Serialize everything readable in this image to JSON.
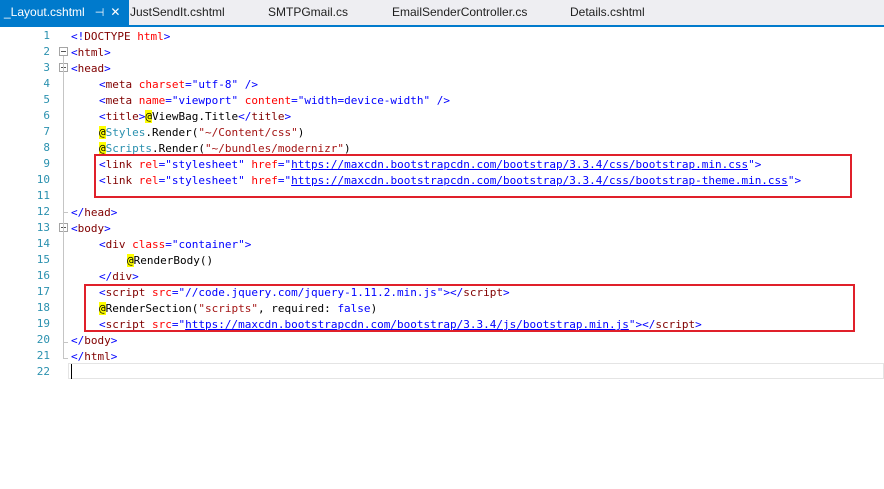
{
  "tabs": [
    {
      "label": "_Layout.cshtml",
      "active": true
    },
    {
      "label": "JustSendIt.cshtml"
    },
    {
      "label": "SMTPGmail.cs"
    },
    {
      "label": "EmailSenderController.cs"
    },
    {
      "label": "Details.cshtml"
    }
  ],
  "tab_icons": {
    "pin": "pin-icon",
    "close": "close-icon"
  },
  "line_numbers": [
    "1",
    "2",
    "3",
    "4",
    "5",
    "6",
    "7",
    "8",
    "9",
    "10",
    "11",
    "12",
    "13",
    "14",
    "15",
    "16",
    "17",
    "18",
    "19",
    "20",
    "21",
    "22"
  ],
  "code": {
    "l1": {
      "lt": "<!",
      "doctype": "DOCTYPE",
      "html": " html",
      "gt": ">"
    },
    "l2": {
      "lt": "<",
      "tag": "html",
      "gt": ">"
    },
    "l3": {
      "lt": "<",
      "tag": "head",
      "gt": ">"
    },
    "l4": {
      "lt": "<",
      "tag": "meta",
      "sp": " ",
      "a1": "charset",
      "eq": "=",
      "v1": "\"utf-8\"",
      "end": " />"
    },
    "l5": {
      "lt": "<",
      "tag": "meta",
      "sp": " ",
      "a1": "name",
      "eq1": "=",
      "v1": "\"viewport\"",
      "sp2": " ",
      "a2": "content",
      "eq2": "=",
      "v2": "\"width=device-width\"",
      "end": " />"
    },
    "l6": {
      "lt": "<",
      "tag": "title",
      "gt": ">",
      "at": "@",
      "expr": "ViewBag.Title",
      "close": "</",
      "ctag": "title",
      "cgt": ">"
    },
    "l7": {
      "at": "@",
      "type": "Styles",
      "rest": ".Render(",
      "str": "\"~/Content/css\"",
      "end": ")"
    },
    "l8": {
      "at": "@",
      "type": "Scripts",
      "rest": ".Render(",
      "str": "\"~/bundles/modernizr\"",
      "end": ")"
    },
    "l9": {
      "lt": "<",
      "tag": "link",
      "sp": " ",
      "a1": "rel",
      "eq1": "=",
      "v1": "\"stylesheet\"",
      "sp2": " ",
      "a2": "href",
      "eq2": "=",
      "q1": "\"",
      "url": "https://maxcdn.bootstrapcdn.com/bootstrap/3.3.4/css/bootstrap.min.css",
      "q2": "\"",
      "gt": ">"
    },
    "l10": {
      "lt": "<",
      "tag": "link",
      "sp": " ",
      "a1": "rel",
      "eq1": "=",
      "v1": "\"stylesheet\"",
      "sp2": " ",
      "a2": "href",
      "eq2": "=",
      "q1": "\"",
      "url": "https://maxcdn.bootstrapcdn.com/bootstrap/3.3.4/css/bootstrap-theme.min.css",
      "q2": "\"",
      "gt": ">"
    },
    "l12": {
      "lt": "</",
      "tag": "head",
      "gt": ">"
    },
    "l13": {
      "lt": "<",
      "tag": "body",
      "gt": ">"
    },
    "l14": {
      "lt": "<",
      "tag": "div",
      "sp": " ",
      "a1": "class",
      "eq": "=",
      "v1": "\"container\"",
      "gt": ">"
    },
    "l15": {
      "at": "@",
      "expr": "RenderBody()"
    },
    "l16": {
      "lt": "</",
      "tag": "div",
      "gt": ">"
    },
    "l17": {
      "lt": "<",
      "tag": "script",
      "sp": " ",
      "a1": "src",
      "eq": "=",
      "v1": "\"//code.jquery.com/jquery-1.11.2.min.js\"",
      "gt": ">",
      "close": "</",
      "ctag": "script",
      "cgt": ">"
    },
    "l18": {
      "at": "@",
      "expr": "RenderSection(",
      "str": "\"scripts\"",
      "rest": ", required: ",
      "kw": "false",
      "end": ")"
    },
    "l19": {
      "lt": "<",
      "tag": "script",
      "sp": " ",
      "a1": "src",
      "eq": "=",
      "q1": "\"",
      "url": "https://maxcdn.bootstrapcdn.com/bootstrap/3.3.4/js/bootstrap.min.js",
      "q2": "\"",
      "gt": ">",
      "close": "</",
      "ctag": "script",
      "cgt": ">"
    },
    "l20": {
      "lt": "</",
      "tag": "body",
      "gt": ">"
    },
    "l21": {
      "lt": "</",
      "tag": "html",
      "gt": ">"
    }
  },
  "colors": {
    "accent": "#007acc",
    "highlight_box": "#e0202a",
    "razor_highlight": "#ffff00",
    "line_number": "#2b91af"
  }
}
